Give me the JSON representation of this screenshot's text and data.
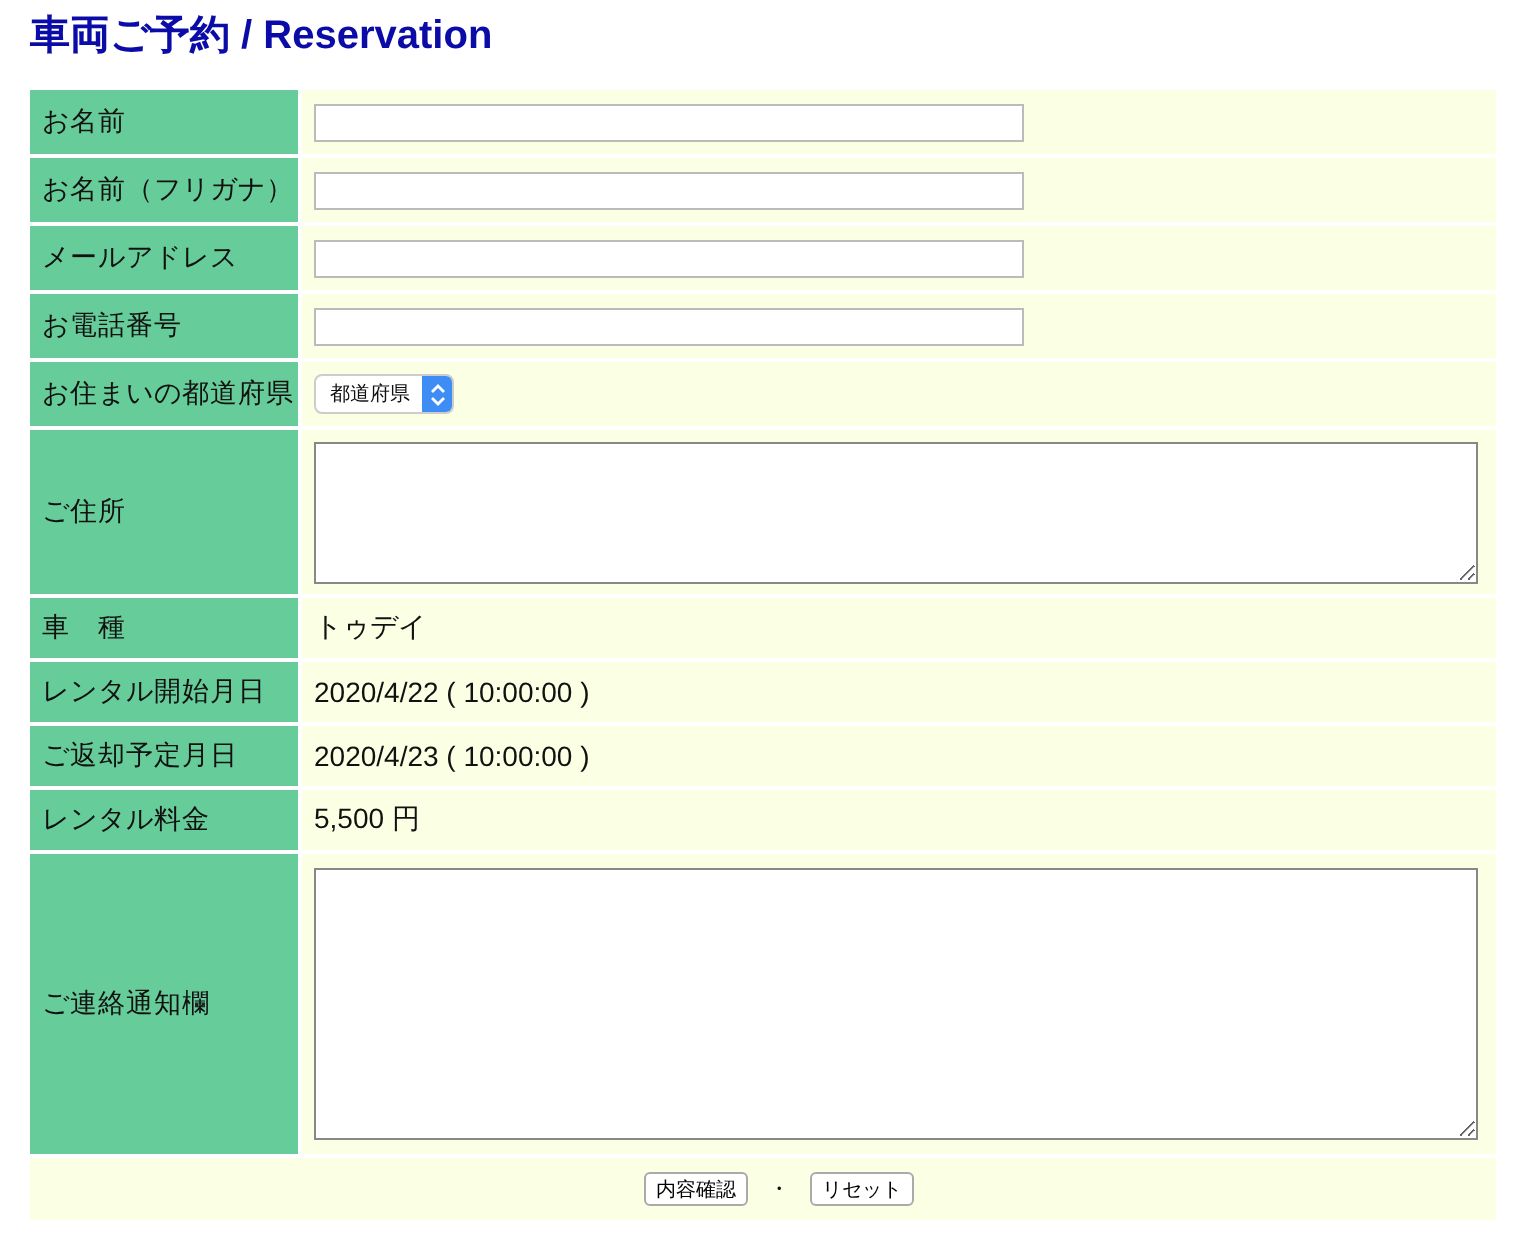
{
  "title": "車両ご予約 / Reservation",
  "rows": [
    {
      "label": "お名前",
      "kind": "text"
    },
    {
      "label": "お名前（フリガナ）",
      "kind": "text"
    },
    {
      "label": "メールアドレス",
      "kind": "text"
    },
    {
      "label": "お電話番号",
      "kind": "text"
    },
    {
      "label": "お住まいの都道府県",
      "kind": "select",
      "value": "都道府県"
    },
    {
      "label": "ご住所",
      "kind": "textarea"
    },
    {
      "label": "車　種",
      "kind": "static",
      "value": "トゥデイ"
    },
    {
      "label": "レンタル開始月日",
      "kind": "static",
      "value": "2020/4/22 ( 10:00:00 )"
    },
    {
      "label": "ご返却予定月日",
      "kind": "static",
      "value": "2020/4/23 ( 10:00:00 )"
    },
    {
      "label": "レンタル料金",
      "kind": "static",
      "value": "5,500 円"
    },
    {
      "label": "ご連絡通知欄",
      "kind": "memo"
    }
  ],
  "actions": {
    "buttons": [
      "内容確認",
      "リセット"
    ],
    "separator": "・"
  }
}
